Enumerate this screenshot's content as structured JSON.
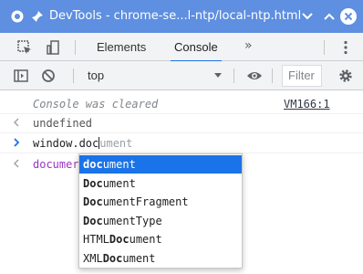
{
  "window": {
    "title": "DevTools - chrome-se...l-ntp/local-ntp.html",
    "accent": "#5e8fe0"
  },
  "tabs": {
    "elements": "Elements",
    "console": "Console",
    "more": "»"
  },
  "toolbar": {
    "context": "top",
    "filter_placeholder": "Filter"
  },
  "console": {
    "cleared_text": "Console was cleared",
    "cleared_source": "VM166:1",
    "undefined_text": "undefined",
    "input_typed": "window.doc",
    "input_ghost": "ument",
    "eager_partial": "documer"
  },
  "autocomplete": {
    "selected_index": 0,
    "items": [
      {
        "match": "doc",
        "rest": "ument"
      },
      {
        "match": "Doc",
        "rest": "ument"
      },
      {
        "match": "Doc",
        "rest": "umentFragment"
      },
      {
        "match": "Doc",
        "rest": "umentType"
      },
      {
        "prefix": "HTML",
        "match": "Doc",
        "rest": "ument"
      },
      {
        "prefix": "XML",
        "match": "Doc",
        "rest": "ument"
      }
    ]
  }
}
